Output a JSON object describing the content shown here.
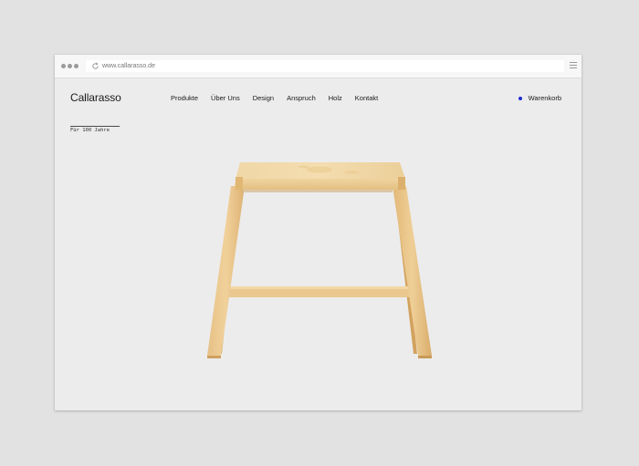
{
  "browser": {
    "url": "www.callarasso.de"
  },
  "site": {
    "brand": "Callarasso",
    "nav": [
      "Produkte",
      "Über Uns",
      "Design",
      "Anspruch",
      "Holz",
      "Kontakt"
    ],
    "cart_label": "Warenkorb",
    "cart_dot_color": "#1f2bd1",
    "tagline": "Für 100 Jahre"
  },
  "product": {
    "image_label": "wooden-stool"
  }
}
